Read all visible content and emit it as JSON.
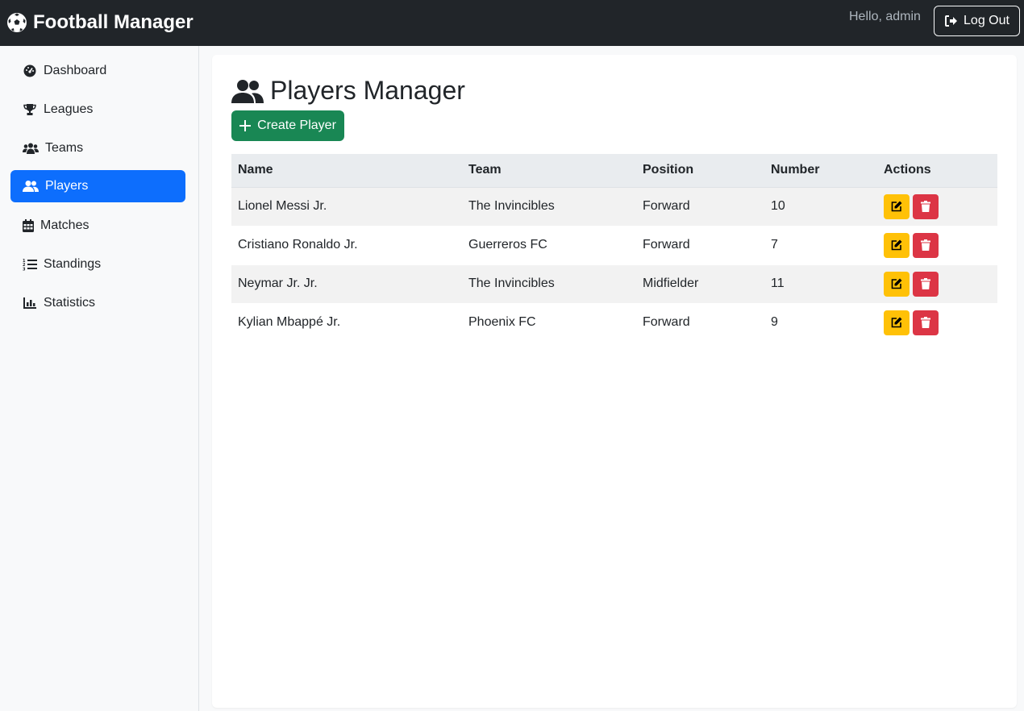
{
  "navbar": {
    "brand": "Football Manager",
    "greeting": "Hello, admin",
    "logout_label": "Log Out"
  },
  "sidebar": {
    "items": [
      {
        "label": "Dashboard",
        "icon": "gauge-icon",
        "active": false
      },
      {
        "label": "Leagues",
        "icon": "trophy-icon",
        "active": false
      },
      {
        "label": "Teams",
        "icon": "users-group-icon",
        "active": false
      },
      {
        "label": "Players",
        "icon": "user-group-icon",
        "active": true
      },
      {
        "label": "Matches",
        "icon": "calendar-icon",
        "active": false
      },
      {
        "label": "Standings",
        "icon": "ordered-list-icon",
        "active": false
      },
      {
        "label": "Statistics",
        "icon": "bar-chart-icon",
        "active": false
      }
    ]
  },
  "main": {
    "title": "Players Manager",
    "create_label": "Create Player",
    "table": {
      "headers": [
        "Name",
        "Team",
        "Position",
        "Number",
        "Actions"
      ],
      "rows": [
        {
          "name": "Lionel Messi Jr.",
          "team": "The Invincibles",
          "position": "Forward",
          "number": "10"
        },
        {
          "name": "Cristiano Ronaldo Jr.",
          "team": "Guerreros FC",
          "position": "Forward",
          "number": "7"
        },
        {
          "name": "Neymar Jr. Jr.",
          "team": "The Invincibles",
          "position": "Midfielder",
          "number": "11"
        },
        {
          "name": "Kylian Mbappé Jr.",
          "team": "Phoenix FC",
          "position": "Forward",
          "number": "9"
        }
      ]
    }
  },
  "colors": {
    "navbar": "#212529",
    "active": "#0d6efd",
    "create": "#198754",
    "edit": "#ffc107",
    "delete": "#dc3545"
  }
}
